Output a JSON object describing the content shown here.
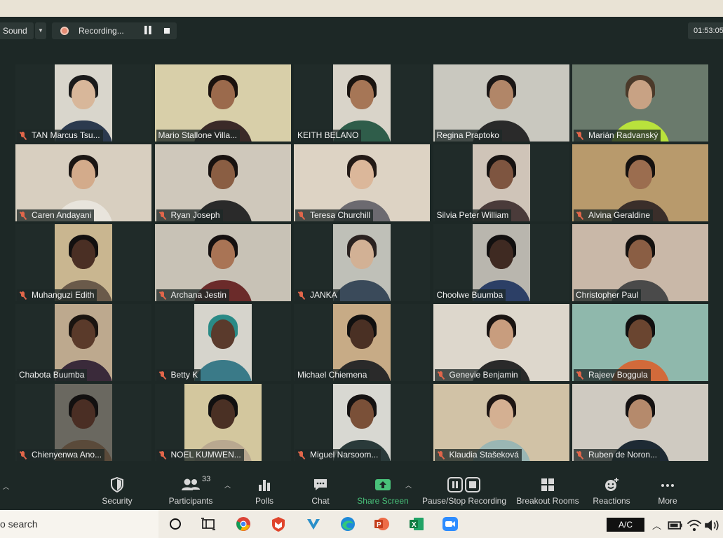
{
  "top_bar": {
    "sound_label": "Sound",
    "recording_label": "Recording...",
    "timer": "01:53:05"
  },
  "participants": [
    {
      "name": "TAN Marcus Tsu...",
      "muted": true,
      "cam": "narrow",
      "bg": "#d9d6cc",
      "skin": "#d8b79a",
      "hair": "#1a1a1a",
      "shirt": "#2c3a4e"
    },
    {
      "name": "Mario Stallone Villa...",
      "muted": false,
      "cam": "full",
      "bg": "#d8cfa9",
      "skin": "#9b6a4c",
      "hair": "#1b120e",
      "shirt": "#3b2a28",
      "active": true
    },
    {
      "name": "KEITH BELANO",
      "muted": false,
      "cam": "narrow",
      "bg": "#d9d4c9",
      "skin": "#a67656",
      "hair": "#1a1410",
      "shirt": "#2f5d4a"
    },
    {
      "name": "Regina Praptoko",
      "muted": false,
      "cam": "full",
      "bg": "#c9c8bf",
      "skin": "#b18668",
      "hair": "#1b1716",
      "shirt": "#2a2a2a"
    },
    {
      "name": "Marián Radvanský",
      "muted": true,
      "cam": "full",
      "bg": "#6a7a6c",
      "skin": "#c8a284",
      "hair": "#4b3a2a",
      "shirt": "#b9e23c"
    },
    {
      "name": "Caren Andayani",
      "muted": true,
      "cam": "full",
      "bg": "#d8cfc0",
      "skin": "#d3ab8b",
      "hair": "#1b1614",
      "shirt": "#e8e4dc"
    },
    {
      "name": "Ryan Joseph",
      "muted": true,
      "cam": "full",
      "bg": "#cfc8bb",
      "skin": "#8a5e43",
      "hair": "#181210",
      "shirt": "#2a2a2a"
    },
    {
      "name": "Teresa Churchill",
      "muted": true,
      "cam": "full",
      "bg": "#ddd3c4",
      "skin": "#dbb79a",
      "hair": "#231a16",
      "shirt": "#6c6a70"
    },
    {
      "name": "Silvia Peter William",
      "muted": false,
      "cam": "narrow",
      "bg": "#cfc4b8",
      "skin": "#7e5540",
      "hair": "#171312",
      "shirt": "#4a3b3a"
    },
    {
      "name": "Alvina Geraldine",
      "muted": true,
      "cam": "full",
      "bg": "#b89a6c",
      "skin": "#9b6d4f",
      "hair": "#161210",
      "shirt": "#3a2e2a"
    },
    {
      "name": "Muhanguzi Edith",
      "muted": true,
      "cam": "narrow",
      "bg": "#c9b690",
      "skin": "#4a2f24",
      "hair": "#121010",
      "shirt": "#6a5a4a"
    },
    {
      "name": "Archana Jestin",
      "muted": true,
      "cam": "full",
      "bg": "#c8c2b6",
      "skin": "#a97455",
      "hair": "#151010",
      "shirt": "#6b2b2a"
    },
    {
      "name": "JANKA",
      "muted": true,
      "cam": "narrow",
      "bg": "#bfc0b8",
      "skin": "#d2b195",
      "hair": "#2a2220",
      "shirt": "#3a4a5a"
    },
    {
      "name": "Choolwe Buumba",
      "muted": false,
      "cam": "narrow",
      "bg": "#b9b6ae",
      "skin": "#3f2a22",
      "hair": "#121010",
      "shirt": "#2c3f66"
    },
    {
      "name": "Christopher Paul",
      "muted": false,
      "cam": "full",
      "bg": "#c9b8a8",
      "skin": "#8a5e44",
      "hair": "#151210",
      "shirt": "#4a4a4a"
    },
    {
      "name": "Chabota Buumba",
      "muted": false,
      "cam": "narrow",
      "bg": "#bda98e",
      "skin": "#5a3a2a",
      "hair": "#1a1410",
      "shirt": "#3a2a3a"
    },
    {
      "name": "Betty  K",
      "muted": true,
      "cam": "narrow",
      "bg": "#d6d4cc",
      "skin": "#5a3a2c",
      "hair": "#2a8a86",
      "shirt": "#3a7a88"
    },
    {
      "name": "Michael Chiemena",
      "muted": false,
      "cam": "narrow",
      "bg": "#c7ab86",
      "skin": "#4a3024",
      "hair": "#111010",
      "shirt": "#2a2a2a"
    },
    {
      "name": "Genevie Benjamin",
      "muted": true,
      "cam": "full",
      "bg": "#ddd7cc",
      "skin": "#c89d7e",
      "hair": "#1a1412",
      "shirt": "#2a2a2a"
    },
    {
      "name": "Rajeev Boggula",
      "muted": true,
      "cam": "full",
      "bg": "#8fb8ac",
      "skin": "#6a4530",
      "hair": "#121010",
      "shirt": "#d26a3a"
    },
    {
      "name": "Chienyenwa Ano...",
      "muted": true,
      "cam": "narrow",
      "bg": "#6a6860",
      "skin": "#4a2e24",
      "hair": "#121010",
      "shirt": "#5a4a3a"
    },
    {
      "name": "NOEL KUMWEN...",
      "muted": true,
      "cam": "mid",
      "bg": "#d3c79e",
      "skin": "#4a3024",
      "hair": "#111010",
      "shirt": "#b9a890"
    },
    {
      "name": "Miguel Narsoom...",
      "muted": true,
      "cam": "narrow",
      "bg": "#d8d8d2",
      "skin": "#7a5038",
      "hair": "#151212",
      "shirt": "#2a3a3a"
    },
    {
      "name": "Klaudia Stašeková",
      "muted": true,
      "cam": "full",
      "bg": "#d1c2a6",
      "skin": "#d4b092",
      "hair": "#1e1614",
      "shirt": "#9ab6b4"
    },
    {
      "name": "Ruben de Noron...",
      "muted": true,
      "cam": "full",
      "bg": "#cfcac1",
      "skin": "#b58a6c",
      "hair": "#151212",
      "shirt": "#1e2a34"
    }
  ],
  "toolbar": {
    "security": "Security",
    "participants": "Participants",
    "participants_count": "33",
    "polls": "Polls",
    "chat": "Chat",
    "share_screen": "Share Screen",
    "pause_stop_recording": "Pause/Stop Recording",
    "breakout_rooms": "Breakout Rooms",
    "reactions": "Reactions",
    "more": "More"
  },
  "taskbar": {
    "search_text": "o search",
    "ac_label": "A/C"
  },
  "colors": {
    "share_green": "#49c27a",
    "active_speaker": "#c8d24b",
    "mute_red": "#e2664a"
  }
}
